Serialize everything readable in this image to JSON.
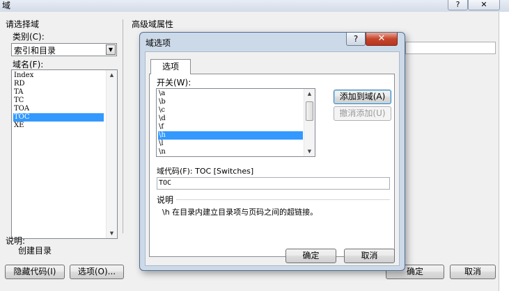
{
  "outer": {
    "title": "域",
    "help_glyph": "?",
    "close_glyph": "✕",
    "choose_field_label": "请选择域",
    "category_label": "类别(C):",
    "category_value": "索引和目录",
    "combo_arrow": "▼",
    "field_names_label": "域名(F):",
    "field_names": [
      "Index",
      "RD",
      "TA",
      "TC",
      "TOA",
      "TOC",
      "XE"
    ],
    "selected_field": "TOC",
    "advanced_label": "高级域属性",
    "desc_label": "说明:",
    "desc_text": "创建目录",
    "hide_codes_button": "隐藏代码(I)",
    "options_button": "选项(O)...",
    "ok_button": "确定",
    "cancel_button": "取消",
    "scroll_up": "▲",
    "scroll_down": "▼"
  },
  "dialog": {
    "title": "域选项",
    "help_glyph": "?",
    "close_glyph": "✕",
    "tab_label": "选项",
    "switches_label": "开关(W):",
    "switches": [
      "\\a",
      "\\b",
      "\\c",
      "\\d",
      "\\f",
      "\\h",
      "\\l",
      "\\n"
    ],
    "selected_switch": "\\h",
    "add_button": "添加到域(A)",
    "undo_button": "撤消添加(U)",
    "field_code_label": "域代码(F): TOC [Switches]",
    "field_code_value": "TOC",
    "desc_label": "说明",
    "desc_text": "\\h 在目录内建立目录项与页码之间的超链接。",
    "ok_button": "确定",
    "cancel_button": "取消",
    "scroll_up": "▲",
    "scroll_down": "▼"
  }
}
